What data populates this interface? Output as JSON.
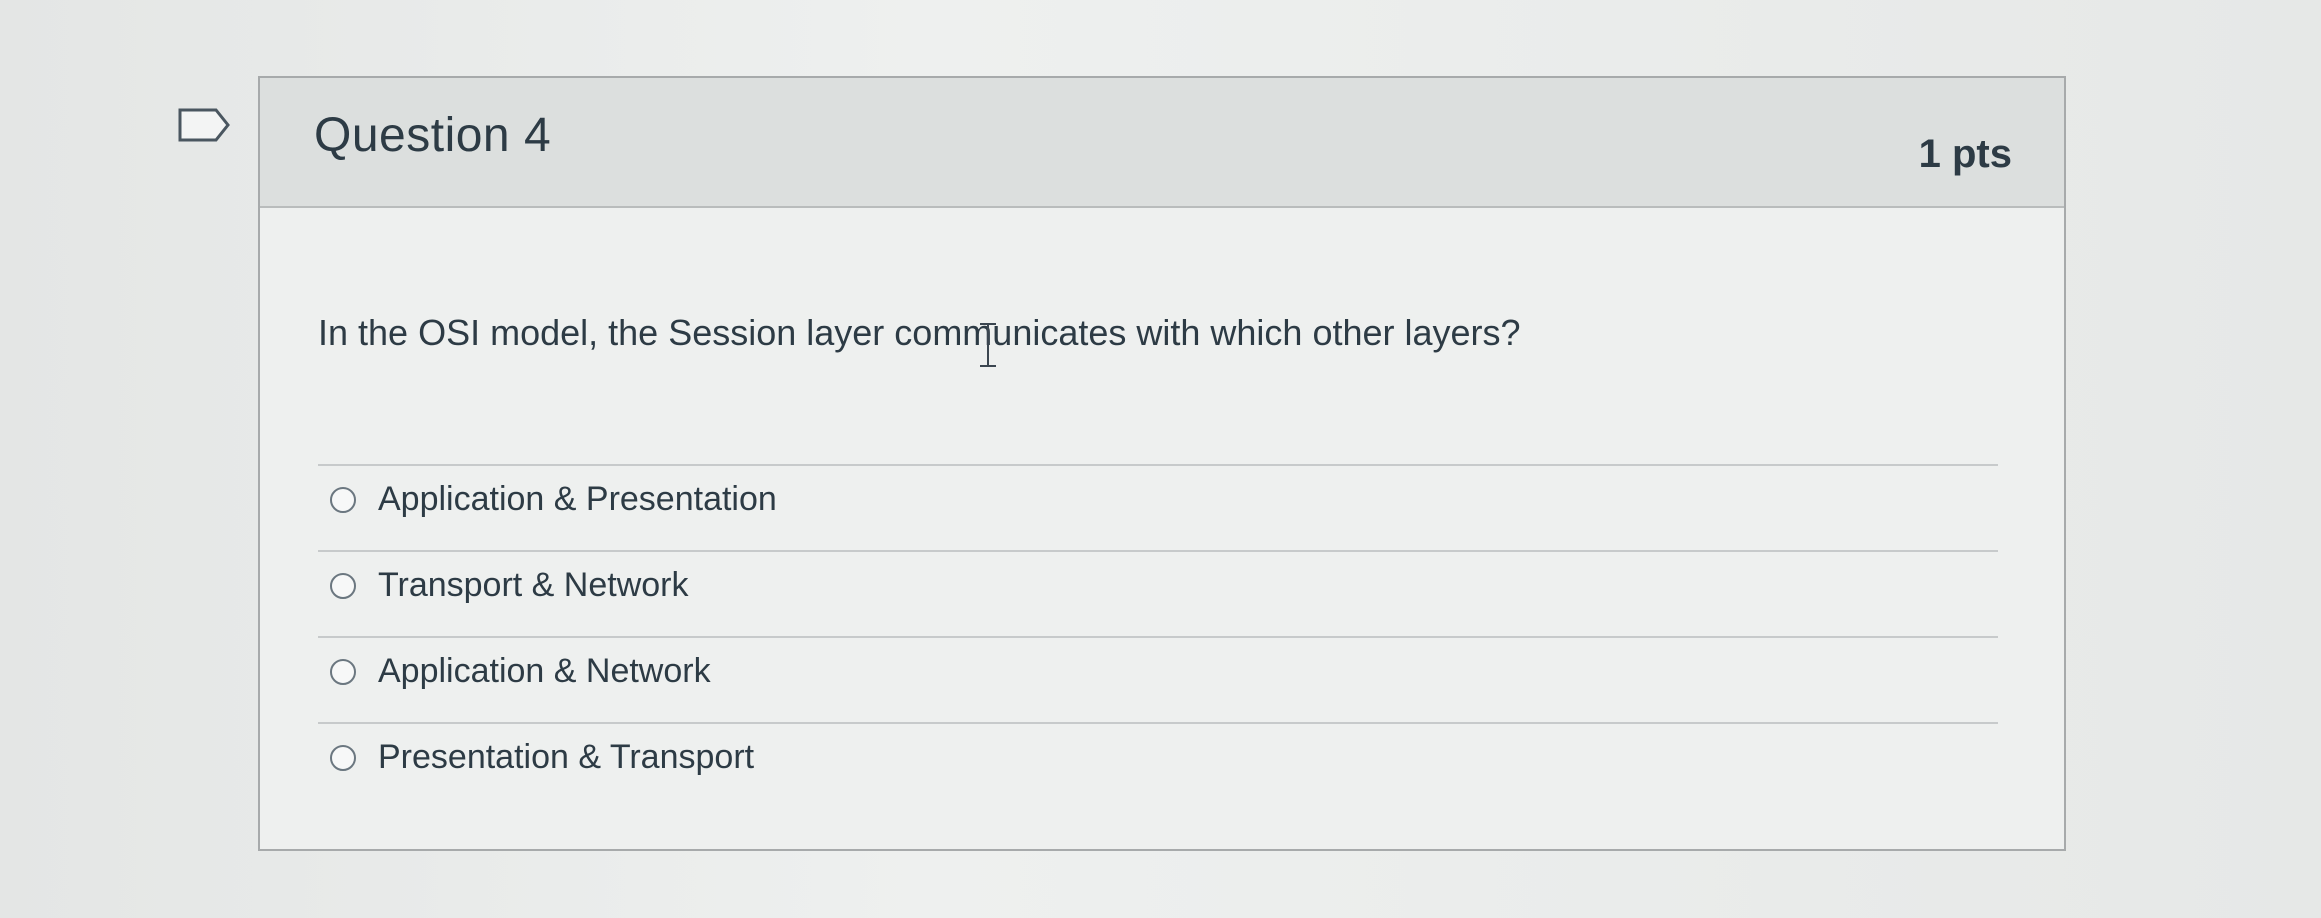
{
  "question": {
    "title": "Question 4",
    "points": "1 pts",
    "prompt": "In the OSI model, the Session layer communicates with which other layers?",
    "answers": [
      {
        "label": "Application & Presentation",
        "selected": false
      },
      {
        "label": "Transport & Network",
        "selected": false
      },
      {
        "label": "Application & Network",
        "selected": false
      },
      {
        "label": "Presentation & Transport",
        "selected": false
      }
    ]
  },
  "icons": {
    "bookmark": "bookmark-flag-icon",
    "cursor": "text-cursor-icon",
    "radio": "radio-unselected-icon"
  },
  "colors": {
    "text": "#2d3b45",
    "header_bg": "#dcdfde",
    "card_border": "#a7aaab"
  }
}
